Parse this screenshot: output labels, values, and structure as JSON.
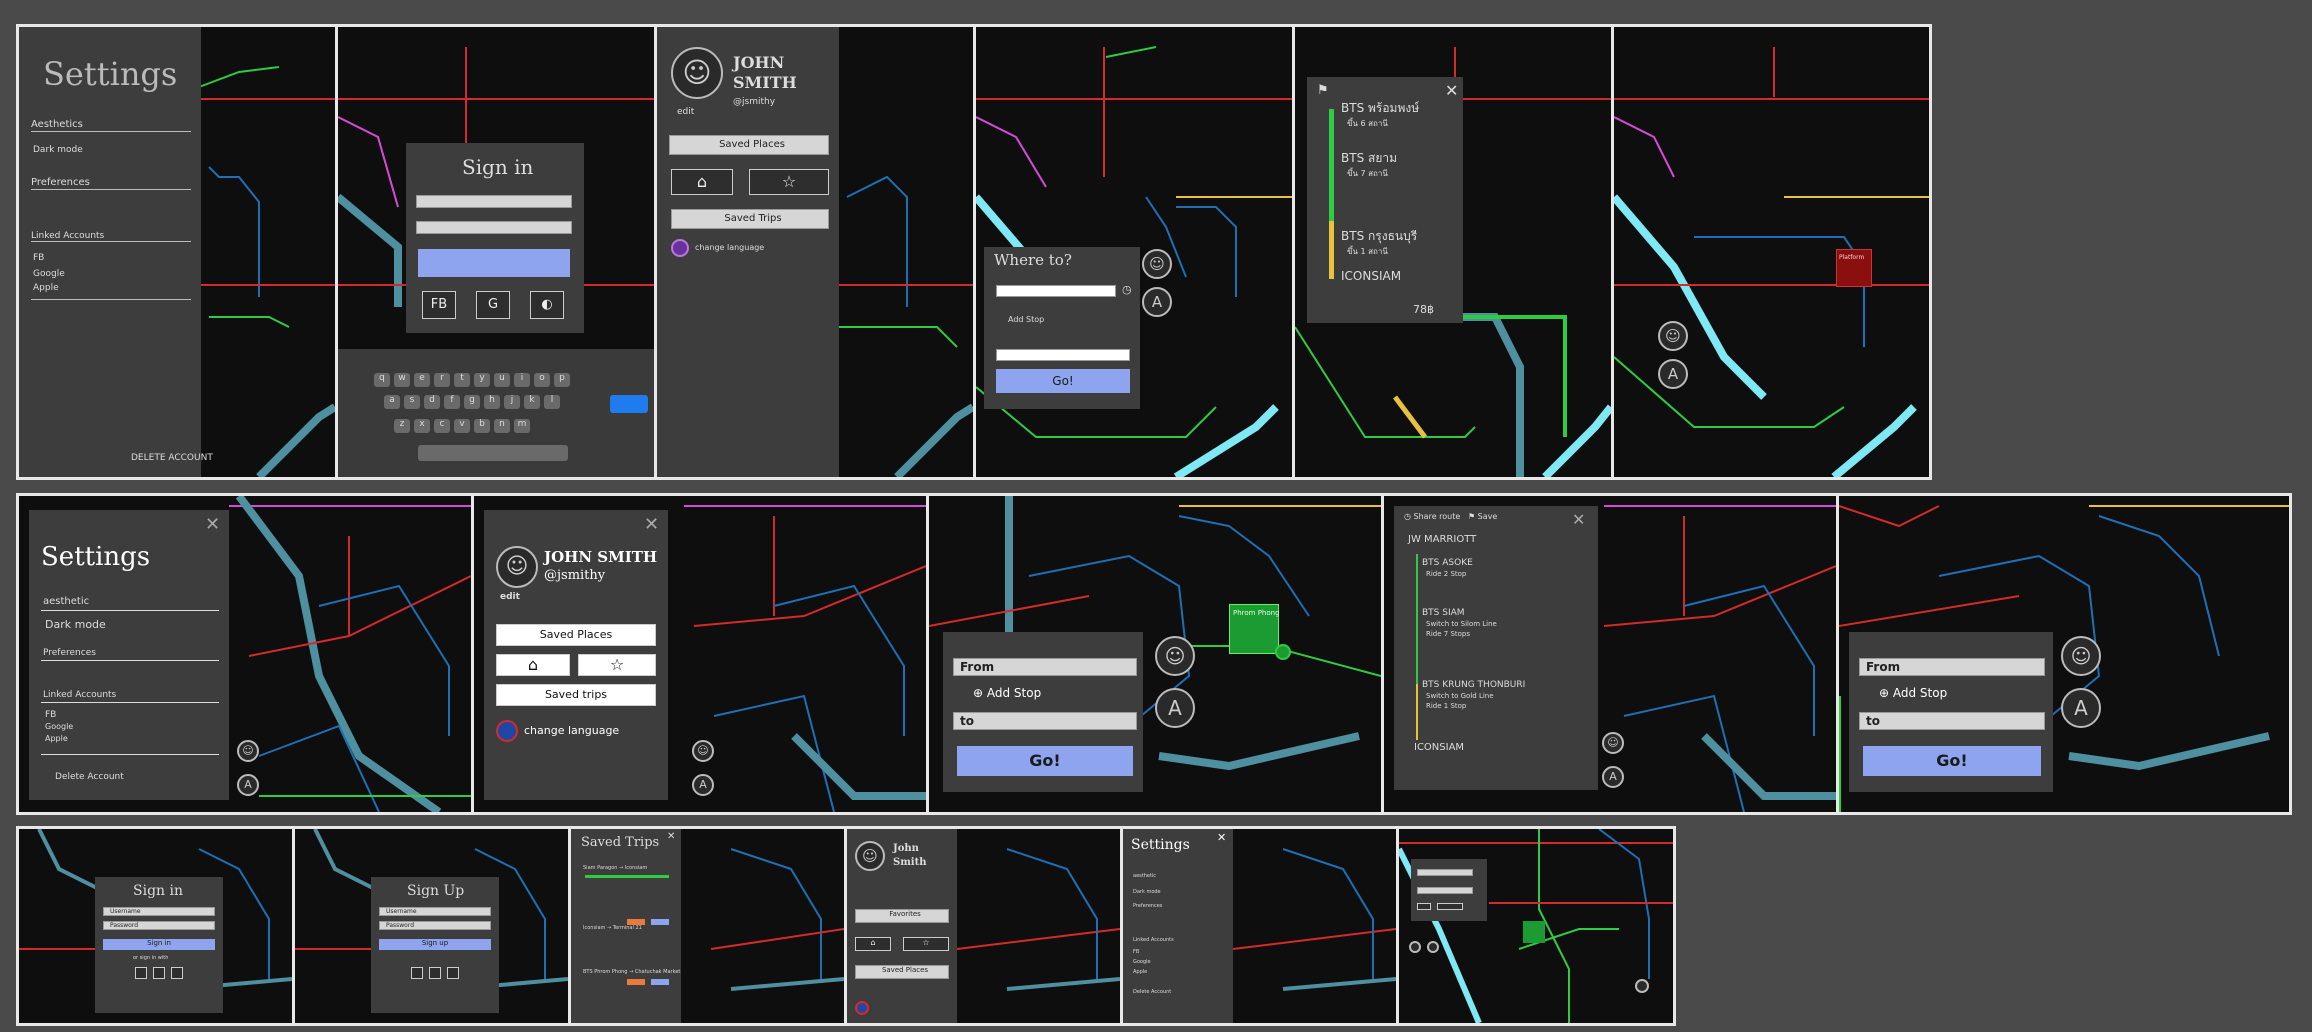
{
  "app": {
    "title": ""
  },
  "settings": {
    "title": "Settings",
    "aesthetics": "Aesthetics",
    "dark_mode": "Dark mode",
    "preferences": "Preferences",
    "linked_accounts": "Linked Accounts",
    "accounts": [
      "FB",
      "Google",
      "Apple"
    ],
    "delete_account": "DELETE ACCOUNT",
    "delete_account_2": "Delete Account",
    "aesthetic_lower": "aesthetic"
  },
  "signin": {
    "title": "Sign in",
    "signup_title": "Sign Up",
    "fb": "FB",
    "google": "G",
    "apple": "",
    "username": "Username",
    "password": "Password",
    "sign_in_btn": "Sign in",
    "sign_up_btn": "Sign up",
    "or_sign_in_with": "or sign in with"
  },
  "profile": {
    "name_line1": "JOHN",
    "name_line2": "SMITH",
    "full_name": "JOHN SMITH",
    "handle": "@jsmithy",
    "edit": "edit",
    "saved_places": "Saved Places",
    "saved_trips": "Saved trips",
    "saved_trips_cap": "Saved Trips",
    "change_language": "change language",
    "favorites": "Favorites",
    "saved_places_2": "Saved Places"
  },
  "route": {
    "where_to": "Where to?",
    "add_stop": "Add Stop",
    "from": "From",
    "to": "to",
    "go": "Go!",
    "place_popup": "Phrom Phong",
    "entry_popup": "Platform"
  },
  "trip": {
    "steps": [
      "BTS พร้อมพงษ์",
      "BTS สยาม",
      "BTS กรุงธนบุรี",
      "ICONSIAM"
    ],
    "notes": [
      "ขึ้น 6 สถานี",
      "ขึ้น 7 สถานี",
      "ขึ้น 1 สถานี"
    ],
    "fare": "78฿",
    "save_label": "Save",
    "share_label": "Share route",
    "en_steps": [
      "JW MARRIOTT",
      "BTS ASOKE",
      "BTS SIAM",
      "BTS KRUNG THONBURI",
      "ICONSIAM"
    ],
    "en_notes": [
      "Ride 2 Stop",
      "Switch to Silom Line",
      "Ride 7 Stops",
      "Switch to Gold Line",
      "Ride 1 Stop"
    ]
  },
  "saved_trips_list": {
    "title": "Saved Trips",
    "items": [
      "Siam Paragon → Iconsiam",
      "Iconsiam → Terminal 21",
      "BTS Phrom Phong → Chatuchak Market"
    ]
  },
  "colors": {
    "background": "#4a4a4a",
    "map_bg": "#0e0e0e",
    "panel": "#3d3d3d",
    "accent": "#8ea4ef",
    "sukhumvit": "#2ecc40",
    "silom": "#1f6fb5",
    "red_line": "#d42a2a",
    "pink_line": "#d64ad8",
    "gold_line": "#e8c23c",
    "cyan_line": "#7ee8f4",
    "teal_line": "#4e8fa0"
  },
  "icons": [
    "close-icon",
    "avatar-icon",
    "compass-icon",
    "home-icon",
    "star-icon",
    "flag-icon",
    "bookmark-icon",
    "clock-icon"
  ]
}
